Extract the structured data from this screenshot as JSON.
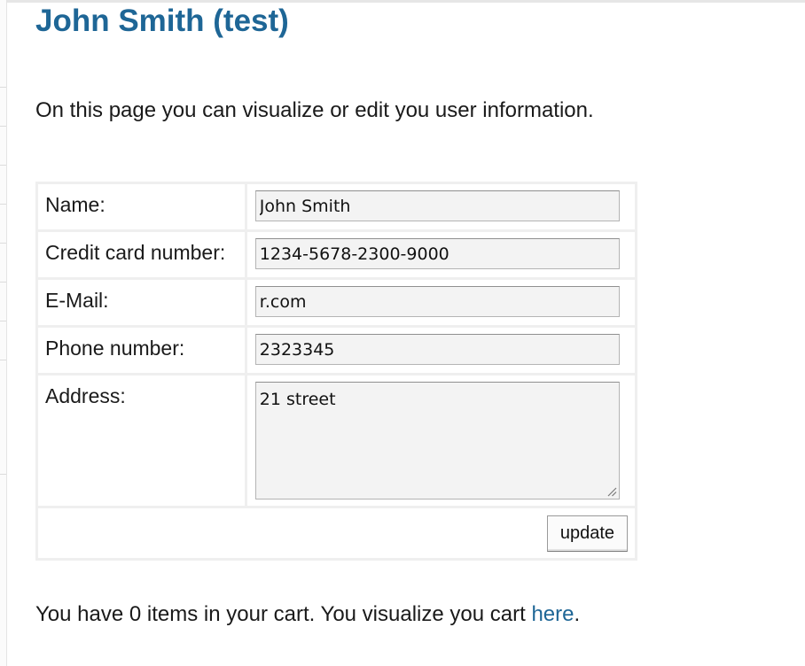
{
  "page": {
    "title": "John Smith (test)",
    "intro": "On this page you can visualize or edit you user information."
  },
  "form": {
    "name_label": "Name:",
    "name_value": "John Smith",
    "card_label": "Credit card number:",
    "card_value": "1234-5678-2300-9000",
    "email_label": "E-Mail:",
    "email_value": "r.com",
    "phone_label": "Phone number:",
    "phone_value": "2323345",
    "address_label": "Address:",
    "address_value": "21 street",
    "update_label": "update"
  },
  "cart": {
    "text_before": "You have 0 items in your cart. You visualize you cart ",
    "link_text": "here",
    "text_after": "."
  },
  "colors": {
    "heading": "#1e6696",
    "link": "#1e6696",
    "field_bg": "#f3f3f3"
  },
  "icons": {
    "resize_grip": "resize-grip-icon"
  }
}
